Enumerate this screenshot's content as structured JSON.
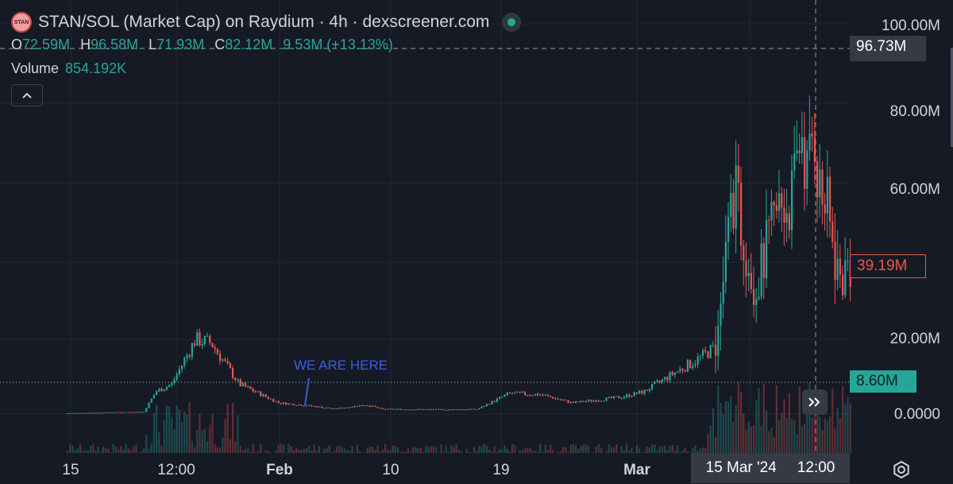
{
  "header": {
    "logo_text": "STAN",
    "title": "STAN/SOL (Market Cap) on Raydium · 4h · dexscreener.com",
    "ohlc": {
      "o_label": "O",
      "o_value": "72.59M",
      "h_label": "H",
      "h_value": "96.58M",
      "l_label": "L",
      "l_value": "71.93M",
      "c_label": "C",
      "c_value": "82.12M",
      "change": "9.53M (+13.13%)"
    },
    "volume_label": "Volume",
    "volume_value": "854.192K",
    "collapse_icon": "chevron-up-icon"
  },
  "price_axis": {
    "labels": [
      "100.00M",
      "80.00M",
      "60.00M",
      "20.00M",
      "0.0000"
    ],
    "crosshair_value": "96.73M",
    "last_value": "39.19M",
    "prev_value": "8.60M"
  },
  "time_axis": {
    "labels": [
      "15",
      "12:00",
      "Feb",
      "10",
      "19",
      "Mar"
    ],
    "crosshair_date": "15 Mar '24",
    "crosshair_time": "12:00"
  },
  "annotation": "WE ARE HERE",
  "colors": {
    "up": "#26a69a",
    "down": "#ef5350",
    "background": "#161a25",
    "annotation": "#3b5dde"
  },
  "chart_data": {
    "type": "candlestick",
    "y_unit": "market cap (USD)",
    "y_ticks": [
      0,
      20000000,
      40000000,
      60000000,
      80000000,
      100000000
    ],
    "ylim": [
      -8000000,
      100000000
    ],
    "approx_series": [
      {
        "date": "Jan 15",
        "close_m": 0.2
      },
      {
        "date": "Jan 22",
        "close_m": 0.5
      },
      {
        "date": "Jan 24",
        "close_m": 7
      },
      {
        "date": "Jan 26",
        "close_m": 20
      },
      {
        "date": "Jan 29",
        "close_m": 7
      },
      {
        "date": "Feb 3",
        "close_m": 2.5
      },
      {
        "date": "Feb 10",
        "close_m": 1.5
      },
      {
        "date": "Feb 19",
        "close_m": 1.2
      },
      {
        "date": "Feb 23",
        "close_m": 5
      },
      {
        "date": "Mar 1",
        "close_m": 5
      },
      {
        "date": "Mar 5",
        "close_m": 13
      },
      {
        "date": "Mar 8",
        "close_m": 60
      },
      {
        "date": "Mar 10",
        "close_m": 35
      },
      {
        "date": "Mar 14",
        "close_m": 80
      },
      {
        "date": "Mar 15",
        "close_m": 96.7
      },
      {
        "date": "Mar 17",
        "close_m": 39.19
      }
    ]
  }
}
